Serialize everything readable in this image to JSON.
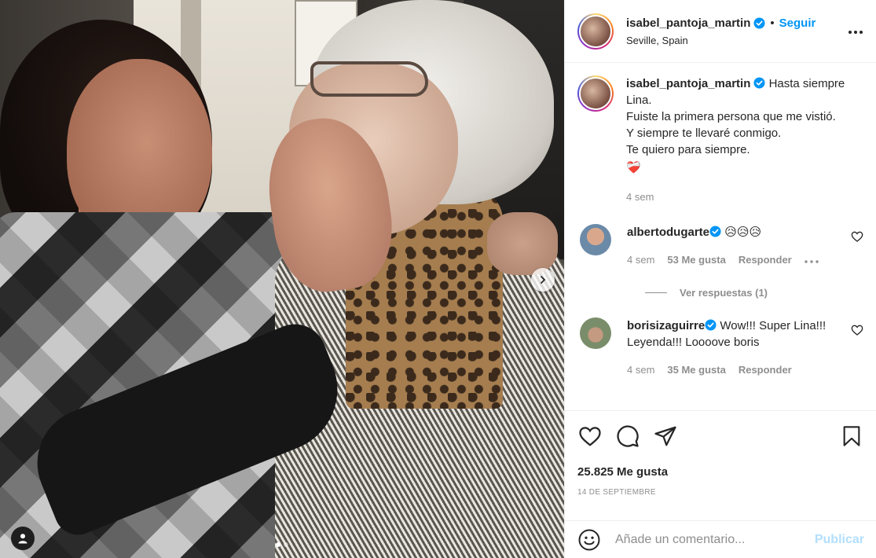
{
  "post": {
    "username": "isabel_pantoja_martin",
    "follow_label": "Seguir",
    "separator": "•",
    "location": "Seville, Spain",
    "more_label": "•••"
  },
  "caption": {
    "username": "isabel_pantoja_martin",
    "lines": [
      "Hasta siempre",
      "Lina.",
      "Fuiste la primera persona que me vistió.",
      "Y siempre te llevaré conmigo.",
      "Te quiero para siempre."
    ],
    "emoji": "❤️‍🩹",
    "time": "4 sem"
  },
  "comments": [
    {
      "username": "albertodugarte",
      "text": "😥😥😥",
      "time": "4 sem",
      "likes": "53 Me gusta",
      "reply": "Responder",
      "more": "•••",
      "avatar_color": "#6b8aa8"
    },
    {
      "username": "borisizaguirre",
      "text": "Wow!!! Super Lina!!! Leyenda!!! Loooove boris",
      "time": "4 sem",
      "likes": "35 Me gusta",
      "reply": "Responder",
      "avatar_color": "#7a8d6a"
    }
  ],
  "view_replies": "Ver respuestas (1)",
  "actions": {
    "icons": [
      "heart-icon",
      "comment-icon",
      "share-icon",
      "bookmark-icon"
    ],
    "likes_count": "25.825 Me gusta",
    "date": "14 DE SEPTIEMBRE"
  },
  "comment_input": {
    "placeholder": "Añade un comentario...",
    "publish": "Publicar"
  },
  "colors": {
    "accent": "#0095f6",
    "publish_disabled": "#b2dffc",
    "muted": "#8e8e8e",
    "text": "#262626"
  }
}
